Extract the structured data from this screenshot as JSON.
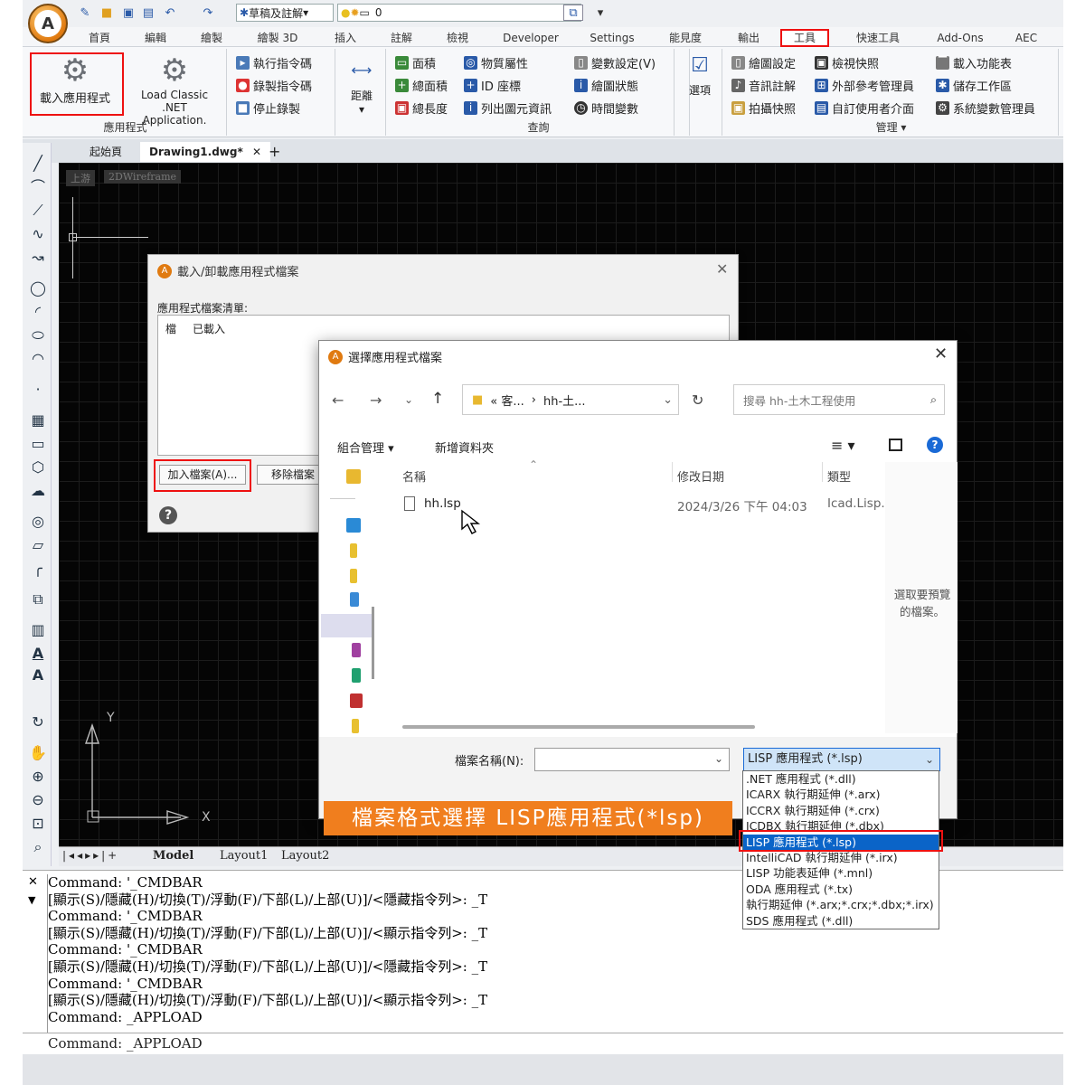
{
  "qat": {
    "style_label": "草稿及註解",
    "layer_value": "0"
  },
  "menu": [
    "首頁",
    "編輯",
    "繪製",
    "繪製 3D",
    "插入",
    "註解",
    "檢視",
    "Developer",
    "Settings",
    "能見度",
    "輸出",
    "工具",
    "快速工具",
    "Add-Ons",
    "AEC"
  ],
  "ribbon": {
    "app_group": {
      "load_app": "載入應用程式",
      "load_net": "Load Classic .NET",
      "load_net2": "Application.",
      "title": "應用程式"
    },
    "macro": [
      "執行指令碼",
      "錄製指令碼",
      "停止錄製"
    ],
    "distance": "距離",
    "query": {
      "col1": [
        "面積",
        "總面積",
        "總長度"
      ],
      "col2": [
        "物質屬性",
        "ID 座標",
        "列出圖元資訊"
      ],
      "col3": [
        "變數設定(V)",
        "繪圖狀態",
        "時間變數"
      ],
      "title": "查詢"
    },
    "options": "選項",
    "manage": {
      "col1": [
        "繪圖設定",
        "音訊註解",
        "拍攝快照"
      ],
      "col2": [
        "檢視快照",
        "外部參考管理員",
        "自訂使用者介面"
      ],
      "col3": [
        "載入功能表",
        "儲存工作區",
        "系統變數管理員"
      ],
      "title": "管理"
    }
  },
  "doctabs": {
    "start": "起始頁",
    "drawing": "Drawing1.dwg*"
  },
  "canvas": {
    "tag1": "上游",
    "tag2": "2DWireframe",
    "axis_y": "Y",
    "axis_x": "X"
  },
  "layouts": [
    "Model",
    "Layout1",
    "Layout2"
  ],
  "command_lines": [
    "Command: '_CMDBAR",
    "[顯示(S)/隱藏(H)/切換(T)/浮動(F)/下部(L)/上部(U)]/<隱藏指令列>: _T",
    "Command: '_CMDBAR",
    "[顯示(S)/隱藏(H)/切換(T)/浮動(F)/下部(L)/上部(U)]/<顯示指令列>: _T",
    "Command: '_CMDBAR",
    "[顯示(S)/隱藏(H)/切換(T)/浮動(F)/下部(L)/上部(U)]/<隱藏指令列>: _T",
    "Command: '_CMDBAR",
    "[顯示(S)/隱藏(H)/切換(T)/浮動(F)/下部(L)/上部(U)]/<顯示指令列>: _T",
    "Command: _APPLOAD"
  ],
  "command_input": "Command: _APPLOAD",
  "dialog1": {
    "title": "載入/卸載應用程式檔案",
    "list_label": "應用程式檔案清單:",
    "col_file": "檔",
    "col_loaded": "已載入",
    "add_btn": "加入檔案(A)...",
    "remove_btn": "移除檔案"
  },
  "dialog2": {
    "title": "選擇應用程式檔案",
    "path1": "« 客...",
    "path2": "hh-土...",
    "search_placeholder": "搜尋 hh-土木工程使用",
    "organize": "組合管理 ▾",
    "new_folder": "新增資料夾",
    "col_name": "名稱",
    "col_date": "修改日期",
    "col_type": "類型",
    "file_name": "hh.lsp",
    "file_date": "2024/3/26 下午 04:03",
    "file_type": "Icad.Lisp.",
    "preview1": "選取要預覽",
    "preview2": "的檔案。",
    "filename_label": "檔案名稱(N):",
    "filetype_value": "LISP 應用程式 (*.lsp)"
  },
  "filetype_options": [
    ".NET 應用程式 (*.dll)",
    "ICARX 執行期延伸 (*.arx)",
    "ICCRX 執行期延伸 (*.crx)",
    "ICDBX 執行期延伸 (*.dbx)",
    "LISP 應用程式 (*.lsp)",
    "IntelliCAD 執行期延伸 (*.irx)",
    "LISP 功能表延伸 (*.mnl)",
    "ODA 應用程式 (*.tx)",
    "執行期延伸 (*.arx;*.crx;*.dbx;*.irx)",
    "SDS 應用程式 (*.dll)"
  ],
  "banner": "檔案格式選擇 LISP應用程式(*lsp)",
  "colors": {
    "highlight_red": "#e11111",
    "banner_orange": "#f07e1e",
    "select_blue": "#0a64c8"
  }
}
